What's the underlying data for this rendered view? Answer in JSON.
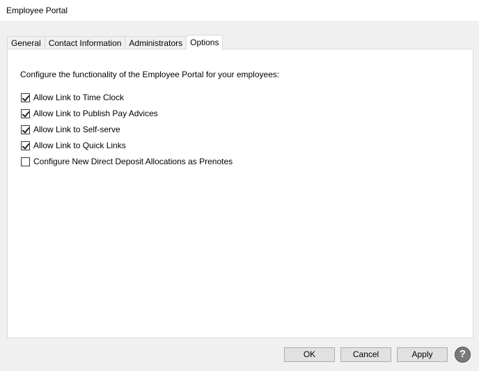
{
  "window": {
    "title": "Employee Portal"
  },
  "tabs": [
    {
      "label": "General"
    },
    {
      "label": "Contact Information"
    },
    {
      "label": "Administrators"
    },
    {
      "label": "Options"
    }
  ],
  "active_tab": "Options",
  "options": {
    "description": "Configure the functionality of the Employee Portal for your employees:",
    "items": [
      {
        "label": "Allow Link to Time Clock",
        "checked": true
      },
      {
        "label": "Allow Link to Publish Pay Advices",
        "checked": true
      },
      {
        "label": "Allow Link to Self-serve",
        "checked": true
      },
      {
        "label": "Allow Link to Quick Links",
        "checked": true
      },
      {
        "label": "Configure New Direct Deposit Allocations as Prenotes",
        "checked": false
      }
    ]
  },
  "buttons": {
    "ok": "OK",
    "cancel": "Cancel",
    "apply": "Apply",
    "help": "?"
  },
  "help_icon": "help-icon"
}
